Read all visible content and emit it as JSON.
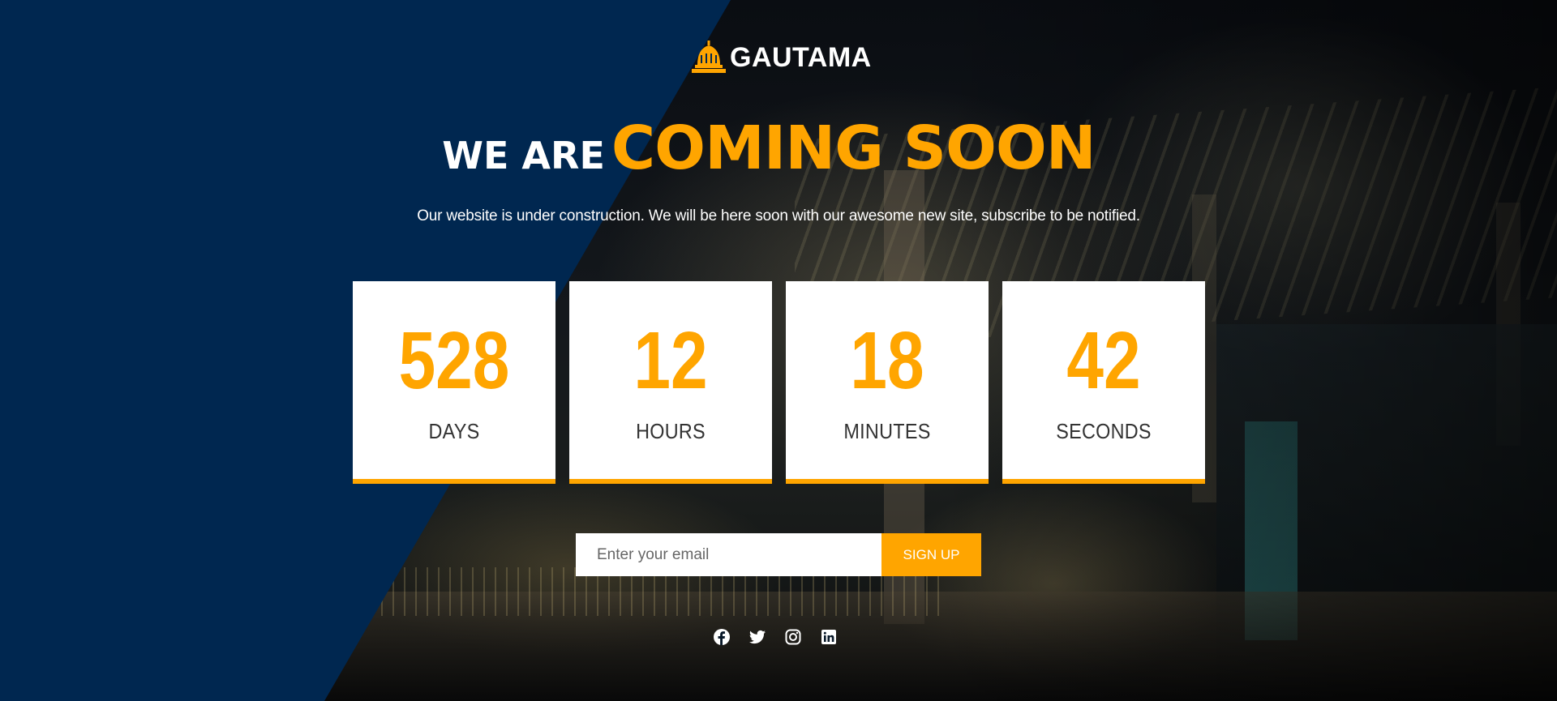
{
  "brand": {
    "name": "GAUTAMA",
    "logo_icon": "dome-icon"
  },
  "headline": {
    "prefix": "WE ARE",
    "main": "COMING SOON"
  },
  "subtitle": "Our website is under construction. We will be here soon with our awesome new site, subscribe to be notified.",
  "countdown": [
    {
      "value": "528",
      "label": "DAYS"
    },
    {
      "value": "12",
      "label": "HOURS"
    },
    {
      "value": "18",
      "label": "MINUTES"
    },
    {
      "value": "42",
      "label": "SECONDS"
    }
  ],
  "subscribe": {
    "placeholder": "Enter your email",
    "button_label": "SIGN UP"
  },
  "social": [
    "facebook-icon",
    "twitter-icon",
    "instagram-icon",
    "linkedin-icon"
  ],
  "colors": {
    "accent": "#ffa500",
    "navy": "#002750",
    "text_light": "#ffffff",
    "label_dark": "#333333"
  }
}
